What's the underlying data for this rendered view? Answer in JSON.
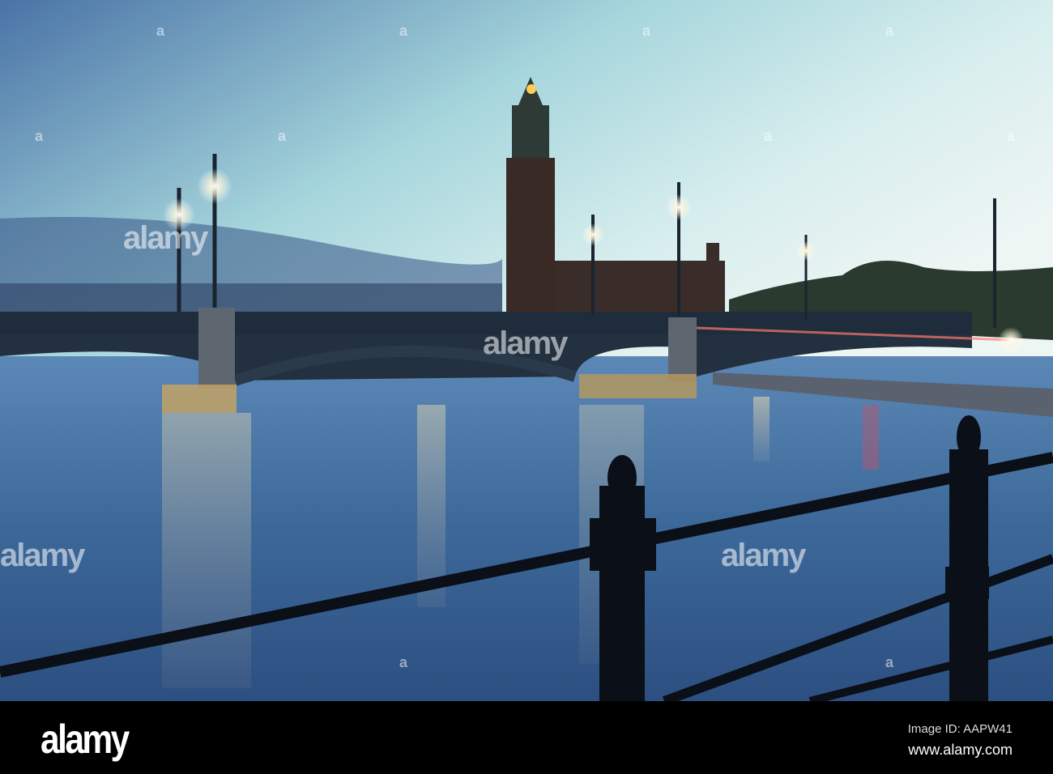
{
  "watermark": {
    "brand": "alamy",
    "mark": "a"
  },
  "footer": {
    "logo": "alamy",
    "image_id": "Image ID: AAPW41",
    "url": "www.alamy.com"
  },
  "colors": {
    "sky_top": "#4f78a8",
    "sky_mid": "#bfe6e6",
    "water": "#3e6c9c",
    "footer": "#000000"
  }
}
